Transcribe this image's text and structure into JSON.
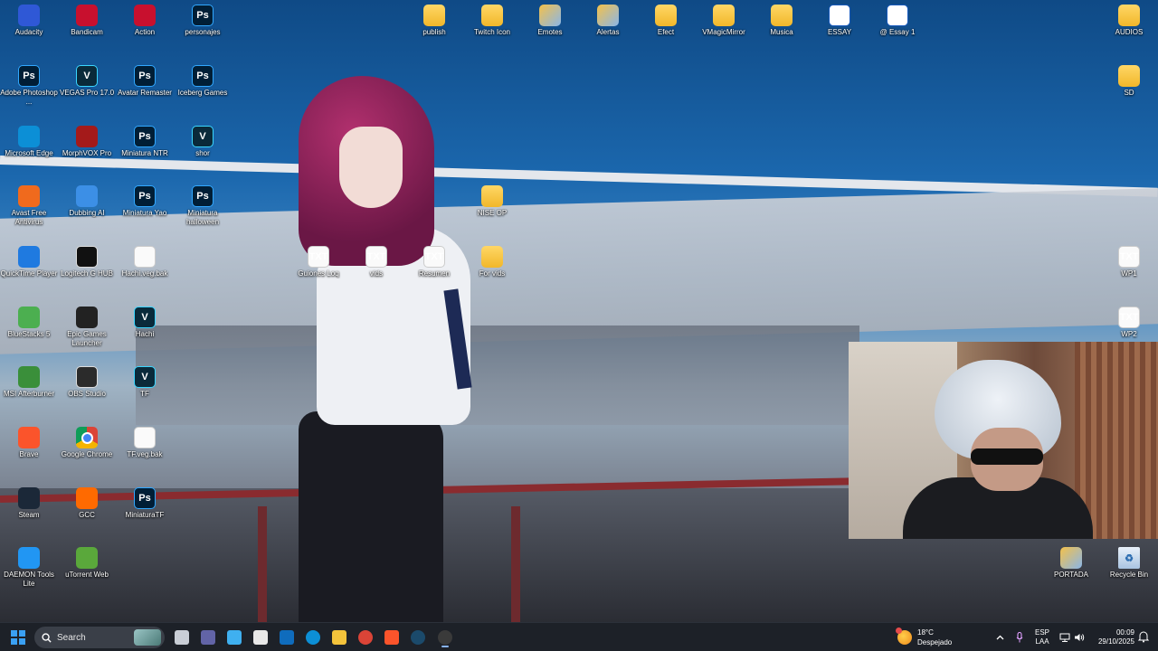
{
  "desktop_icons": [
    {
      "label": "Audacity",
      "icon": "audacity-icon",
      "color": "#2f58d6"
    },
    {
      "label": "Bandicam",
      "icon": "bandicam-icon",
      "color": "#c8102e"
    },
    {
      "label": "Action",
      "icon": "action-icon",
      "color": "#c8102e"
    },
    {
      "label": "personajes",
      "icon": "photoshop-file-icon"
    },
    {
      "label": "Adobe Photoshop ...",
      "icon": "photoshop-icon"
    },
    {
      "label": "VEGAS Pro 17.0",
      "icon": "vegas-icon"
    },
    {
      "label": "Avatar Remaster",
      "icon": "photoshop-file-icon"
    },
    {
      "label": "Iceberg Games",
      "icon": "photoshop-file-icon"
    },
    {
      "label": "Microsoft Edge",
      "icon": "edge-icon",
      "color": "#0c8fd6"
    },
    {
      "label": "MorphVOX Pro",
      "icon": "morphvox-icon",
      "color": "#a41a1a"
    },
    {
      "label": "Miniatura NTR",
      "icon": "photoshop-file-icon"
    },
    {
      "label": "shor",
      "icon": "vegas-file-icon"
    },
    {
      "label": "Avast Free Antivirus",
      "icon": "avast-icon",
      "color": "#f06a1d"
    },
    {
      "label": "Dubbing AI",
      "icon": "dubbing-ai-icon",
      "color": "#3c8fe6"
    },
    {
      "label": "Miniatura Yao",
      "icon": "photoshop-file-icon"
    },
    {
      "label": "Miniatura halloween",
      "icon": "photoshop-file-icon"
    },
    {
      "label": "QuickTime Player",
      "icon": "quicktime-icon",
      "color": "#1f7ae0"
    },
    {
      "label": "Logitech G HUB",
      "icon": "logitech-icon",
      "color": "#111111"
    },
    {
      "label": "Hachi.veg.bak",
      "icon": "file-icon"
    },
    {
      "label": "BlueStacks 5",
      "icon": "bluestacks-icon",
      "color": "#4caf50"
    },
    {
      "label": "Epic Games Launcher",
      "icon": "epic-games-icon",
      "color": "#222222"
    },
    {
      "label": "Hachi",
      "icon": "vegas-file-icon"
    },
    {
      "label": "MSI Afterburner",
      "icon": "msi-afterburner-icon",
      "color": "#3a8f3a"
    },
    {
      "label": "OBS Studio",
      "icon": "obs-icon",
      "color": "#2b2b2b"
    },
    {
      "label": "TF",
      "icon": "vegas-file-icon"
    },
    {
      "label": "Brave",
      "icon": "brave-icon",
      "color": "#fb542b"
    },
    {
      "label": "Google Chrome",
      "icon": "chrome-icon"
    },
    {
      "label": "TF.veg.bak",
      "icon": "file-icon"
    },
    {
      "label": "Steam",
      "icon": "steam-icon",
      "color": "#1b2838"
    },
    {
      "label": "GCC",
      "icon": "gcc-icon",
      "color": "#ff6a00"
    },
    {
      "label": "MiniaturaTF",
      "icon": "photoshop-file-icon"
    },
    {
      "label": "DAEMON Tools Lite",
      "icon": "daemon-tools-icon",
      "color": "#2196f3"
    },
    {
      "label": "uTorrent Web",
      "icon": "utorrent-icon",
      "color": "#5aa83b"
    },
    {
      "label": "Guiones Loq",
      "icon": "text-file-icon"
    },
    {
      "label": "vids",
      "icon": "text-file-icon"
    },
    {
      "label": "Resumen",
      "icon": "text-file-icon"
    },
    {
      "label": "For vids",
      "icon": "folder-icon"
    },
    {
      "label": "NISE OP",
      "icon": "folder-icon"
    },
    {
      "label": "publish",
      "icon": "folder-icon"
    },
    {
      "label": "Twitch Icon",
      "icon": "folder-icon"
    },
    {
      "label": "Emotes",
      "icon": "image-folder-icon"
    },
    {
      "label": "Alertas",
      "icon": "image-folder-icon"
    },
    {
      "label": "Efect",
      "icon": "folder-icon"
    },
    {
      "label": "VMagicMirror",
      "icon": "folder-icon"
    },
    {
      "label": "Musica",
      "icon": "folder-icon"
    },
    {
      "label": "ESSAY",
      "icon": "word-icon"
    },
    {
      "label": "@ Essay 1",
      "icon": "word-icon"
    },
    {
      "label": "AUDIOS",
      "icon": "folder-icon"
    },
    {
      "label": "SD",
      "icon": "folder-icon"
    },
    {
      "label": "WP1",
      "icon": "text-file-icon"
    },
    {
      "label": "WP2",
      "icon": "text-file-icon"
    },
    {
      "label": "PORTADA",
      "icon": "image-folder-icon"
    },
    {
      "label": "Recycle Bin",
      "icon": "recycle-bin-icon"
    }
  ],
  "taskbar": {
    "search_placeholder": "Search",
    "apps": [
      {
        "name": "task-view-icon",
        "color": "#c9ced6"
      },
      {
        "name": "teams-icon",
        "color": "#6264a7"
      },
      {
        "name": "copilot-icon",
        "color": "#3fb0f0"
      },
      {
        "name": "microsoft-store-icon",
        "color": "#e8e8e8"
      },
      {
        "name": "outlook-icon",
        "color": "#0f6cbd"
      },
      {
        "name": "edge-icon",
        "color": "#0c8fd6"
      },
      {
        "name": "file-explorer-icon",
        "color": "#f3c33b"
      },
      {
        "name": "chrome-icon",
        "color": "#db4437"
      },
      {
        "name": "brave-icon",
        "color": "#fb542b"
      },
      {
        "name": "steam-icon",
        "color": "#1b4a6b"
      },
      {
        "name": "obs-icon",
        "color": "#3a3a3a"
      }
    ],
    "weather": {
      "temp": "18°C",
      "condition": "Despejado"
    },
    "language": {
      "line1": "ESP",
      "line2": "LAA"
    },
    "clock": {
      "time": "00:09",
      "date": "29/10/2025"
    }
  }
}
